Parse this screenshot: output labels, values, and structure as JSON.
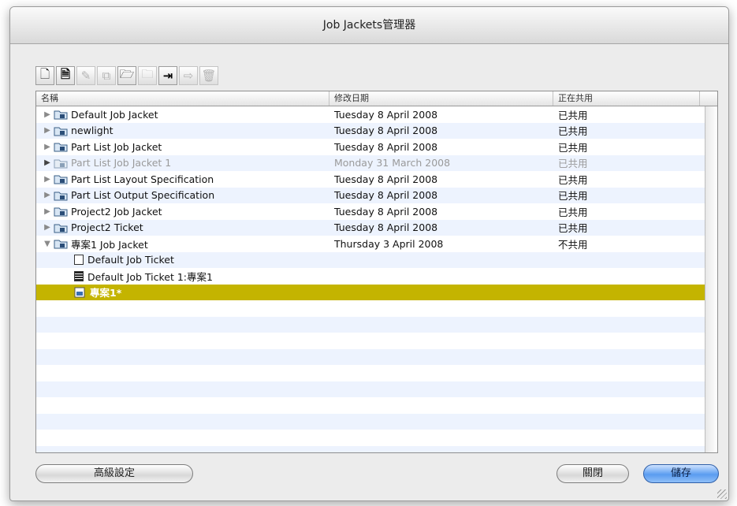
{
  "window": {
    "title": "Job Jackets管理器"
  },
  "toolbar": {
    "buttons": [
      {
        "name": "new-jacket-button",
        "glyph": "🗋",
        "state": "normal"
      },
      {
        "name": "new-ticket-button",
        "glyph": "🗎",
        "state": "bold"
      },
      {
        "name": "edit-button",
        "glyph": "✎",
        "state": "dim"
      },
      {
        "name": "duplicate-button",
        "glyph": "⧉",
        "state": "dim"
      },
      {
        "name": "open-folder-button",
        "glyph": "🗁",
        "state": "normal"
      },
      {
        "name": "link-folder-button",
        "glyph": "🗀",
        "state": "dim"
      },
      {
        "name": "import-button",
        "glyph": "⇥",
        "state": "bold"
      },
      {
        "name": "export-button",
        "glyph": "⇨",
        "state": "dim"
      },
      {
        "name": "delete-button",
        "glyph": "🗑",
        "state": "dim"
      }
    ]
  },
  "list": {
    "columns": {
      "name": "名稱",
      "date": "修改日期",
      "share": "正在共用"
    },
    "rows": [
      {
        "name": "Default Job Jacket",
        "date": "Tuesday 8 April 2008",
        "share": "已共用"
      },
      {
        "name": "newlight",
        "date": "Tuesday 8 April 2008",
        "share": "已共用"
      },
      {
        "name": "Part List Job Jacket",
        "date": "Tuesday 8 April 2008",
        "share": "已共用"
      },
      {
        "name": "Part List Job Jacket 1",
        "date": "Monday 31 March 2008",
        "share": "已共用"
      },
      {
        "name": "Part List Layout Specification",
        "date": "Tuesday 8 April 2008",
        "share": "已共用"
      },
      {
        "name": "Part List Output Specification",
        "date": "Tuesday 8 April 2008",
        "share": "已共用"
      },
      {
        "name": "Project2 Job Jacket",
        "date": "Tuesday 8 April 2008",
        "share": "已共用"
      },
      {
        "name": "Project2 Ticket",
        "date": "Tuesday 8 April 2008",
        "share": "已共用"
      },
      {
        "name": "專案1 Job Jacket",
        "date": "Thursday 3 April 2008",
        "share": "不共用"
      },
      {
        "name": "Default Job Ticket"
      },
      {
        "name": "Default Job Ticket 1:專案1"
      },
      {
        "name": "專案1*"
      }
    ]
  },
  "buttons": {
    "advanced": "高級設定",
    "close": "關閉",
    "save": "儲存"
  },
  "colors": {
    "selection": "#c4b400",
    "stripe": "#edf3fe",
    "default_button": "#5a9cf0"
  }
}
